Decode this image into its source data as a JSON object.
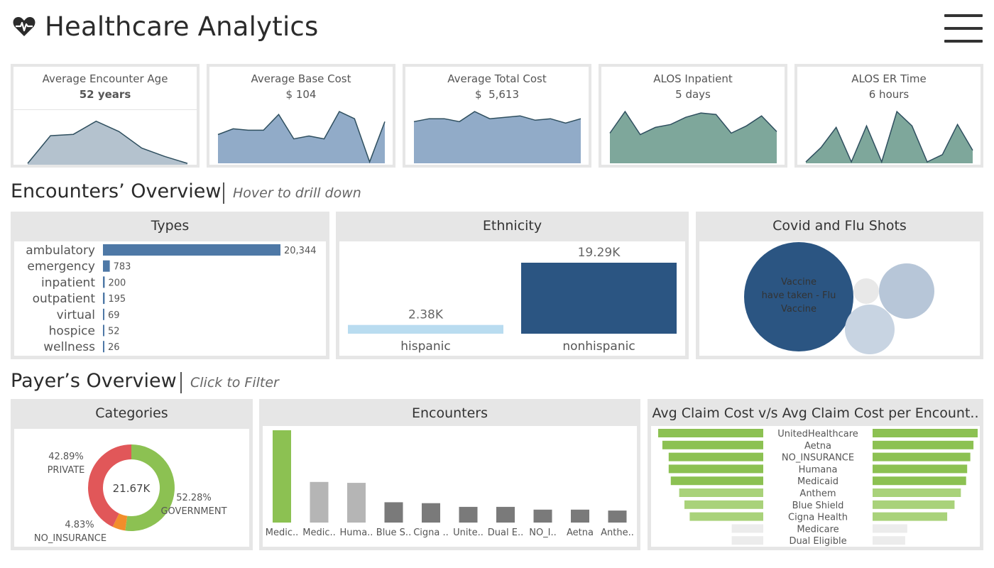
{
  "header": {
    "title": "Healthcare Analytics"
  },
  "kpis": [
    {
      "label": "Average Encounter Age",
      "value": "52 years"
    },
    {
      "label": "Average Base Cost",
      "value": "$ 104"
    },
    {
      "label": "Average Total Cost",
      "value": "$  5,613"
    },
    {
      "label": "ALOS Inpatient",
      "value": "5 days"
    },
    {
      "label": "ALOS ER Time",
      "value": "6 hours"
    }
  ],
  "encounters_section": {
    "title": "Encounters’ Overview",
    "hint": "Hover to drill down"
  },
  "payers_section": {
    "title": "Payer’s Overview",
    "hint": "Click to Filter"
  },
  "panels": {
    "types": "Types",
    "ethnicity": "Ethnicity",
    "covid": "Covid and Flu Shots",
    "categories": "Categories",
    "encounters": "Encounters",
    "claims": "Avg Claim Cost v/s Avg Claim Cost per Encount.."
  },
  "colors": {
    "kpi_gray": "#b4c2ce",
    "kpi_blue": "#91abc8",
    "kpi_green": "#7ea79b",
    "bar_blue": "#4e78a6",
    "ethnicity_light": "#b9dcf0",
    "ethnicity_dark": "#2b5582",
    "donut_red": "#e15759",
    "donut_green": "#8cc152",
    "donut_orange": "#f28e2b",
    "payer_green": "#8cc152",
    "payer_gray": "#b5b5b5",
    "payer_dark_gray": "#7a7a7a"
  },
  "chart_data": [
    {
      "id": "kpi-age-spark",
      "type": "area",
      "title": "Average Encounter Age",
      "values": [
        2,
        42,
        44,
        63,
        48,
        24,
        12,
        2
      ],
      "ylim": [
        0,
        75
      ]
    },
    {
      "id": "kpi-base-spark",
      "type": "area",
      "title": "Average Base Cost",
      "values": [
        40,
        48,
        46,
        46,
        68,
        34,
        38,
        34,
        72,
        62,
        2,
        58
      ],
      "ylim": [
        0,
        80
      ]
    },
    {
      "id": "kpi-total-spark",
      "type": "area",
      "title": "Average Total Cost",
      "values": [
        58,
        62,
        62,
        58,
        72,
        62,
        64,
        66,
        60,
        62,
        56,
        62
      ],
      "ylim": [
        0,
        80
      ]
    },
    {
      "id": "kpi-alos-spark",
      "type": "area",
      "title": "ALOS Inpatient",
      "values": [
        42,
        72,
        40,
        50,
        54,
        64,
        70,
        68,
        42,
        52,
        66,
        44
      ],
      "ylim": [
        0,
        80
      ]
    },
    {
      "id": "kpi-er-spark",
      "type": "area",
      "title": "ALOS ER Time",
      "values": [
        2,
        22,
        50,
        2,
        52,
        2,
        72,
        52,
        2,
        12,
        54,
        18
      ],
      "ylim": [
        0,
        80
      ]
    },
    {
      "id": "types-bars",
      "type": "bar",
      "title": "Types",
      "categories": [
        "ambulatory",
        "emergency",
        "inpatient",
        "outpatient",
        "virtual",
        "hospice",
        "wellness"
      ],
      "values": [
        20344,
        783,
        200,
        195,
        69,
        52,
        26
      ],
      "labels": [
        "20,344",
        "783",
        "200",
        "195",
        "69",
        "52",
        "26"
      ]
    },
    {
      "id": "ethnicity-bars",
      "type": "bar",
      "title": "Ethnicity",
      "categories": [
        "hispanic",
        "nonhispanic"
      ],
      "values": [
        2380,
        19290
      ],
      "labels": [
        "2.38K",
        "19.29K"
      ]
    },
    {
      "id": "covid-bubbles",
      "type": "scatter",
      "title": "Covid and Flu Shots",
      "labels": [
        "Vaccine",
        "have taken - Flu",
        "Vaccine"
      ]
    },
    {
      "id": "categories-donut",
      "type": "pie",
      "title": "Categories",
      "center_label": "21.67K",
      "slices": [
        {
          "name": "GOVERNMENT",
          "pct": 52.28,
          "label": "52.28%"
        },
        {
          "name": "NO_INSURANCE",
          "pct": 4.83,
          "label": "4.83%"
        },
        {
          "name": "PRIVATE",
          "pct": 42.89,
          "label": "42.89%"
        }
      ]
    },
    {
      "id": "encounters-bars",
      "type": "bar",
      "title": "Encounters",
      "categories": [
        "Medic..",
        "Medic..",
        "Huma..",
        "Blue S..",
        "Cigna ..",
        "Unite..",
        "Dual E..",
        "NO_I..",
        "Aetna",
        "Anthe.."
      ],
      "values": [
        100,
        44,
        43,
        22,
        21,
        17,
        17,
        14,
        14,
        13
      ]
    },
    {
      "id": "claims-butterfly",
      "type": "bar",
      "title": "Avg Claim Cost v/s Avg Claim Cost per Encount..",
      "categories": [
        "UnitedHealthcare",
        "Aetna",
        "NO_INSURANCE",
        "Humana",
        "Medicaid",
        "Anthem",
        "Blue Shield",
        "Cigna Health",
        "Medicare",
        "Dual Eligible"
      ],
      "left_values": [
        100,
        96,
        90,
        90,
        88,
        80,
        75,
        70,
        30,
        30
      ],
      "right_values": [
        100,
        96,
        93,
        90,
        89,
        84,
        78,
        71,
        33,
        31
      ]
    }
  ]
}
